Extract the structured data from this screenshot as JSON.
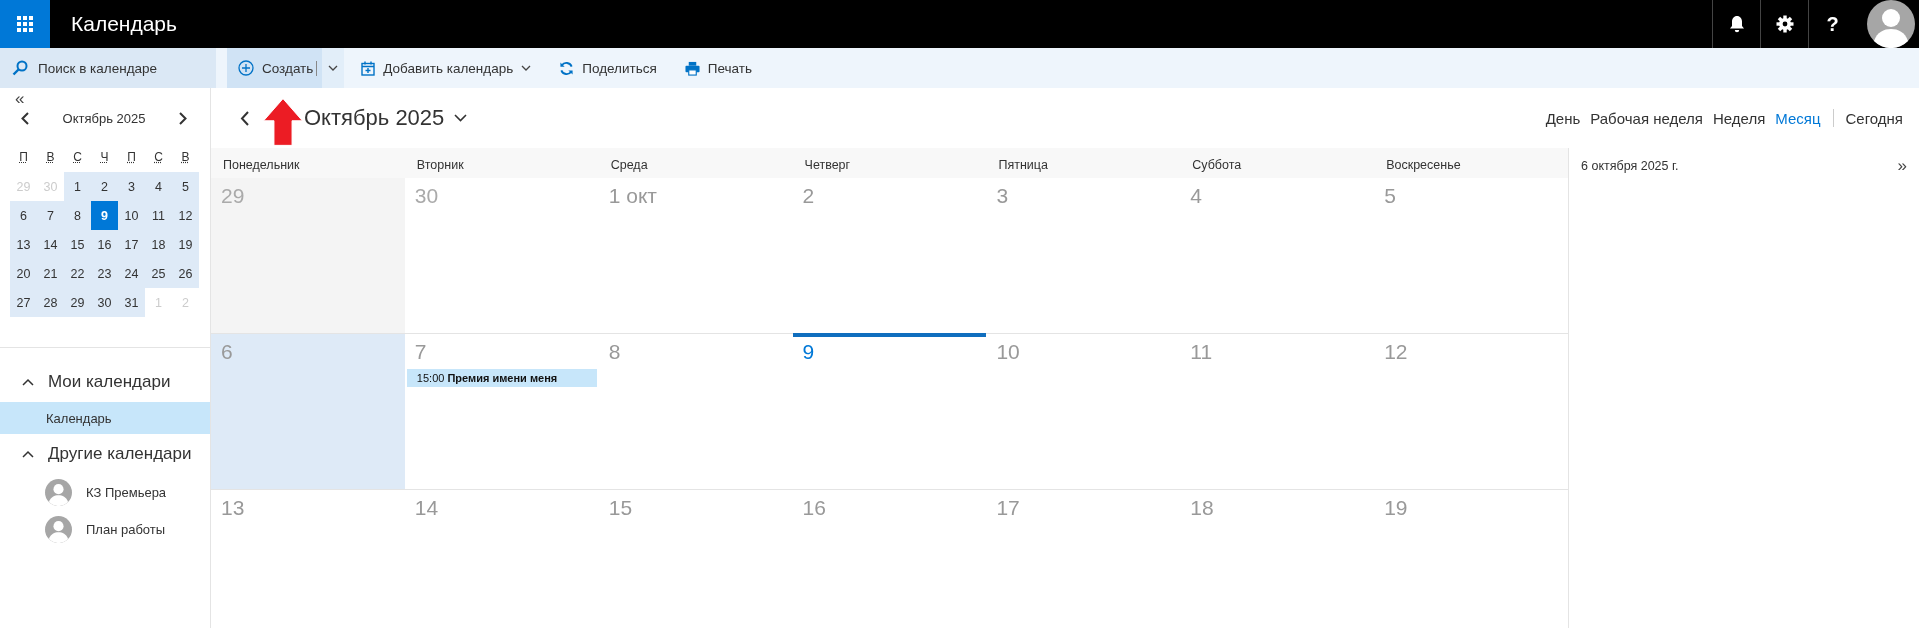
{
  "app": {
    "title": "Календарь",
    "help": "?"
  },
  "toolbar": {
    "search": {
      "placeholder": "Поиск в календаре"
    },
    "buttons": [
      {
        "label": "Создать",
        "kind": "new",
        "dropdown": true
      },
      {
        "label": "Добавить календарь",
        "kind": "add",
        "dropdown": true
      },
      {
        "label": "Поделиться",
        "kind": "share",
        "dropdown": false
      },
      {
        "label": "Печать",
        "kind": "print",
        "dropdown": false
      }
    ]
  },
  "mini_calendar": {
    "collapse": "«",
    "month": "Октябрь 2025",
    "weekdays": [
      "П",
      "В",
      "С",
      "Ч",
      "П",
      "С",
      "В"
    ],
    "weeks": [
      [
        {
          "day": "29",
          "in_month": false,
          "selected": false
        },
        {
          "day": "30",
          "in_month": false,
          "selected": false
        },
        {
          "day": "1",
          "in_month": true,
          "selected": false
        },
        {
          "day": "2",
          "in_month": true,
          "selected": false
        },
        {
          "day": "3",
          "in_month": true,
          "selected": false
        },
        {
          "day": "4",
          "in_month": true,
          "selected": false
        },
        {
          "day": "5",
          "in_month": true,
          "selected": false
        }
      ],
      [
        {
          "day": "6",
          "in_month": true,
          "selected": false
        },
        {
          "day": "7",
          "in_month": true,
          "selected": false
        },
        {
          "day": "8",
          "in_month": true,
          "selected": false
        },
        {
          "day": "9",
          "in_month": true,
          "selected": true
        },
        {
          "day": "10",
          "in_month": true,
          "selected": false
        },
        {
          "day": "11",
          "in_month": true,
          "selected": false
        },
        {
          "day": "12",
          "in_month": true,
          "selected": false
        }
      ],
      [
        {
          "day": "13",
          "in_month": true,
          "selected": false
        },
        {
          "day": "14",
          "in_month": true,
          "selected": false
        },
        {
          "day": "15",
          "in_month": true,
          "selected": false
        },
        {
          "day": "16",
          "in_month": true,
          "selected": false
        },
        {
          "day": "17",
          "in_month": true,
          "selected": false
        },
        {
          "day": "18",
          "in_month": true,
          "selected": false
        },
        {
          "day": "19",
          "in_month": true,
          "selected": false
        }
      ],
      [
        {
          "day": "20",
          "in_month": true,
          "selected": false
        },
        {
          "day": "21",
          "in_month": true,
          "selected": false
        },
        {
          "day": "22",
          "in_month": true,
          "selected": false
        },
        {
          "day": "23",
          "in_month": true,
          "selected": false
        },
        {
          "day": "24",
          "in_month": true,
          "selected": false
        },
        {
          "day": "25",
          "in_month": true,
          "selected": false
        },
        {
          "day": "26",
          "in_month": true,
          "selected": false
        }
      ],
      [
        {
          "day": "27",
          "in_month": true,
          "selected": false
        },
        {
          "day": "28",
          "in_month": true,
          "selected": false
        },
        {
          "day": "29",
          "in_month": true,
          "selected": false
        },
        {
          "day": "30",
          "in_month": true,
          "selected": false
        },
        {
          "day": "31",
          "in_month": true,
          "selected": false
        },
        {
          "day": "1",
          "in_month": false,
          "selected": false
        },
        {
          "day": "2",
          "in_month": false,
          "selected": false
        }
      ]
    ]
  },
  "sidebar": {
    "sections": [
      {
        "title": "Мои календари",
        "expanded": true,
        "items": [
          {
            "label": "Календарь",
            "kind": "calendar",
            "selected": true
          }
        ]
      },
      {
        "title": "Другие календари",
        "expanded": true,
        "items": [
          {
            "label": "КЗ Премьера",
            "kind": "person",
            "selected": false
          },
          {
            "label": "План работы",
            "kind": "person",
            "selected": false
          }
        ]
      }
    ]
  },
  "main": {
    "title": "Октябрь 2025",
    "views": [
      {
        "label": "День",
        "selected": false
      },
      {
        "label": "Рабочая неделя",
        "selected": false
      },
      {
        "label": "Неделя",
        "selected": false
      },
      {
        "label": "Месяц",
        "selected": true
      }
    ],
    "today_button": "Сегодня",
    "weekdays": [
      "Понедельник",
      "Вторник",
      "Среда",
      "Четверг",
      "Пятница",
      "Суббота",
      "Воскресенье"
    ],
    "weeks": [
      [
        {
          "label": "29",
          "other_month": true,
          "selected": false,
          "today": false
        },
        {
          "label": "30",
          "other_month": true,
          "selected": false,
          "today": false
        },
        {
          "label": "1 окт",
          "other_month": false,
          "selected": false,
          "today": false
        },
        {
          "label": "2",
          "other_month": false,
          "selected": false,
          "today": false
        },
        {
          "label": "3",
          "other_month": false,
          "selected": false,
          "today": false
        },
        {
          "label": "4",
          "other_month": false,
          "selected": false,
          "today": false
        },
        {
          "label": "5",
          "other_month": false,
          "selected": false,
          "today": false
        }
      ],
      [
        {
          "label": "6",
          "other_month": false,
          "selected": true,
          "today": false
        },
        {
          "label": "7",
          "other_month": false,
          "selected": false,
          "today": false,
          "events": [
            {
              "time": "15:00",
              "title": "Премия имени меня"
            }
          ]
        },
        {
          "label": "8",
          "other_month": false,
          "selected": false,
          "today": false
        },
        {
          "label": "9",
          "other_month": false,
          "selected": false,
          "today": true
        },
        {
          "label": "10",
          "other_month": false,
          "selected": false,
          "today": false
        },
        {
          "label": "11",
          "other_month": false,
          "selected": false,
          "today": false
        },
        {
          "label": "12",
          "other_month": false,
          "selected": false,
          "today": false
        }
      ],
      [
        {
          "label": "13",
          "other_month": false,
          "selected": false,
          "today": false
        },
        {
          "label": "14",
          "other_month": false,
          "selected": false,
          "today": false
        },
        {
          "label": "15",
          "other_month": false,
          "selected": false,
          "today": false
        },
        {
          "label": "16",
          "other_month": false,
          "selected": false,
          "today": false
        },
        {
          "label": "17",
          "other_month": false,
          "selected": false,
          "today": false
        },
        {
          "label": "18",
          "other_month": false,
          "selected": false,
          "today": false
        },
        {
          "label": "19",
          "other_month": false,
          "selected": false,
          "today": false
        }
      ]
    ]
  },
  "day_panel": {
    "title": "6 октября 2025 г.",
    "expand": "»"
  }
}
